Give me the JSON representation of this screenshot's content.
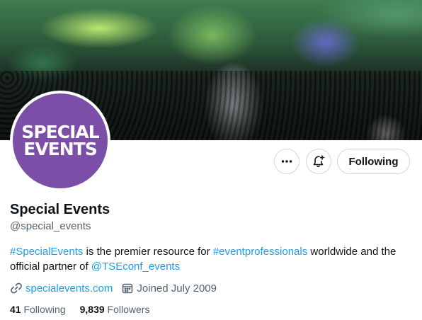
{
  "profile": {
    "avatar_text": [
      "SPECIAL",
      "EVENTS"
    ],
    "name": "Special Events",
    "handle": "@special_events"
  },
  "actions": {
    "more_icon": "ellipsis-icon",
    "notify_icon": "bell-plus-icon",
    "follow_label": "Following"
  },
  "bio": {
    "tag1": "#SpecialEvents",
    "text1": " is the premier resource for ",
    "tag2": "#eventprofessionals",
    "text2": " worldwide and the official partner of ",
    "mention": "@TSEconf_events"
  },
  "meta": {
    "website": "specialevents.com",
    "joined": "Joined July 2009"
  },
  "stats": {
    "following_count": "41",
    "following_label": "Following",
    "followers_count": "9,839",
    "followers_label": "Followers"
  },
  "colors": {
    "accent": "#1d9bf0",
    "avatar_bg": "#7b4fa8",
    "muted": "#536471"
  }
}
